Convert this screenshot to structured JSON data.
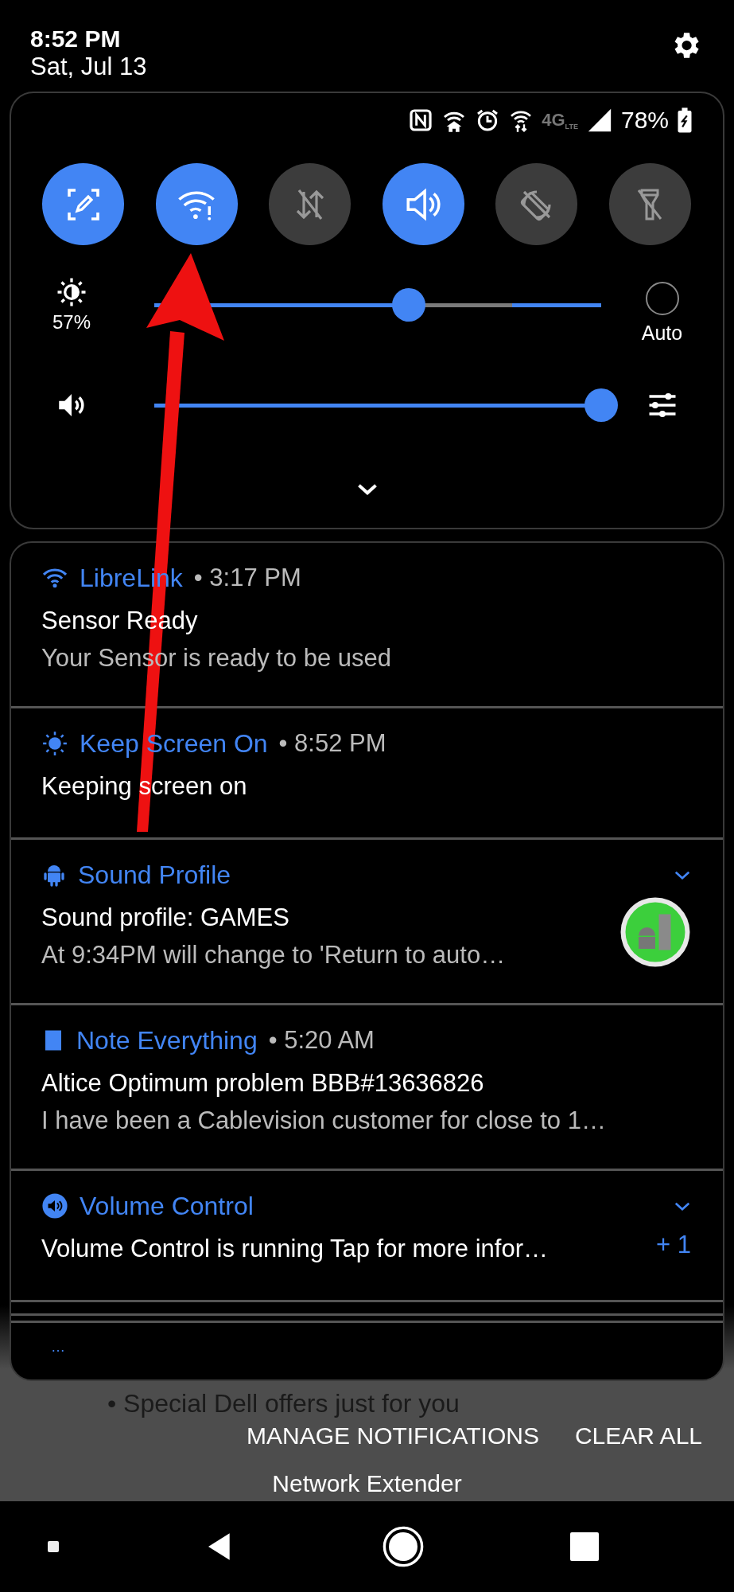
{
  "clock": {
    "time": "8:52 PM",
    "date": "Sat, Jul 13"
  },
  "status_bar": {
    "icons": [
      {
        "kind": "nfc"
      },
      {
        "kind": "home_wifi"
      },
      {
        "kind": "alarm"
      },
      {
        "kind": "wifi_data"
      }
    ],
    "network": {
      "label": "4G",
      "sub": "LTE",
      "disabled": true
    },
    "battery": "78%"
  },
  "tiles": [
    {
      "kind": "screenshot",
      "on": true
    },
    {
      "kind": "wifi",
      "on": true
    },
    {
      "kind": "data",
      "on": false
    },
    {
      "kind": "sound",
      "on": true
    },
    {
      "kind": "rotation",
      "on": false
    },
    {
      "kind": "flashlight",
      "on": false
    }
  ],
  "brightness": {
    "level": 0.57,
    "reading": "57%",
    "auto_label": "Auto",
    "auto": false
  },
  "volume": {
    "level": 1
  },
  "notifications": [
    {
      "kind": "wifi",
      "app": "LibreLink",
      "time": "• 3:17 PM",
      "title": "Sensor Ready",
      "body": "Your Sensor is ready to be used",
      "expandable": false
    },
    {
      "kind": "sun",
      "app": "Keep Screen On",
      "time": "• 8:52 PM",
      "title": "Keeping screen on",
      "expandable": false
    },
    {
      "kind": "android",
      "app": "Sound Profile",
      "title": "Sound profile: GAMES",
      "body": "At 9:34PM will change to 'Return to auto…",
      "expandable": true,
      "thumbnail": true
    },
    {
      "kind": "note",
      "app": "Note Everything",
      "time": "• 5:20 AM",
      "title": "Altice Optimum problem BBB#13636826",
      "body": "I have been a Cablevision customer for close to 1…",
      "expandable": false
    },
    {
      "kind": "volume",
      "app": "Volume Control",
      "title": "Volume Control is running Tap for more infor…",
      "count": "+ 1",
      "expandable": true
    }
  ],
  "more": "…",
  "background": {
    "bullet": "• Special Dell offers just for you"
  },
  "actions": [
    "MANAGE NOTIFICATIONS",
    "CLEAR ALL"
  ],
  "footer": "Network Extender",
  "annotation": {
    "kind": "arrow"
  }
}
